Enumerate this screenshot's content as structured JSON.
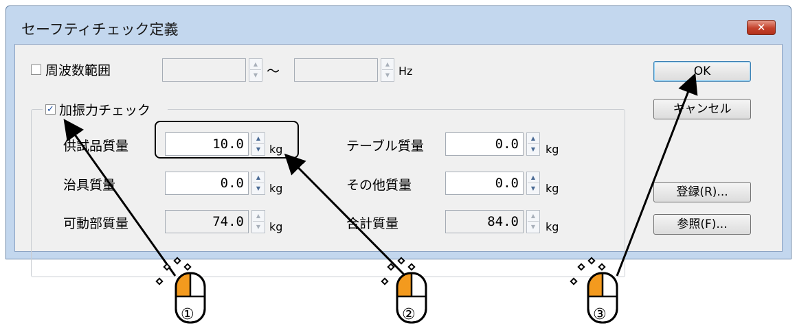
{
  "window": {
    "title": "セーフティチェック定義",
    "close_glyph": "✕"
  },
  "freq": {
    "label": "周波数範囲",
    "checked": false,
    "min_value": "",
    "max_value": "",
    "tilde": "～",
    "unit": "Hz"
  },
  "vib_check": {
    "label": "加振力チェック",
    "checked": true,
    "check_glyph": "✓"
  },
  "fields": {
    "test_mass": {
      "label": "供試品質量",
      "value": "10.0",
      "unit": "kg"
    },
    "jig_mass": {
      "label": "治具質量",
      "value": "0.0",
      "unit": "kg"
    },
    "moving_mass": {
      "label": "可動部質量",
      "value": "74.0",
      "unit": "kg"
    },
    "table_mass": {
      "label": "テーブル質量",
      "value": "0.0",
      "unit": "kg"
    },
    "other_mass": {
      "label": "その他質量",
      "value": "0.0",
      "unit": "kg"
    },
    "total_mass": {
      "label": "合計質量",
      "value": "84.0",
      "unit": "kg"
    }
  },
  "buttons": {
    "ok": "OK",
    "cancel": "キャンセル",
    "register": "登録(R)...",
    "reference": "参照(F)..."
  },
  "spin_glyphs": {
    "up": "▲",
    "down": "▼"
  },
  "callouts": {
    "one": "①",
    "two": "②",
    "three": "③"
  },
  "colors": {
    "mouse_button": "#f39a1e",
    "client_bg": "#f0f0f0",
    "frame": "#c3d7ee"
  },
  "icons": [
    "mouse-icon",
    "sparkle-icon"
  ]
}
